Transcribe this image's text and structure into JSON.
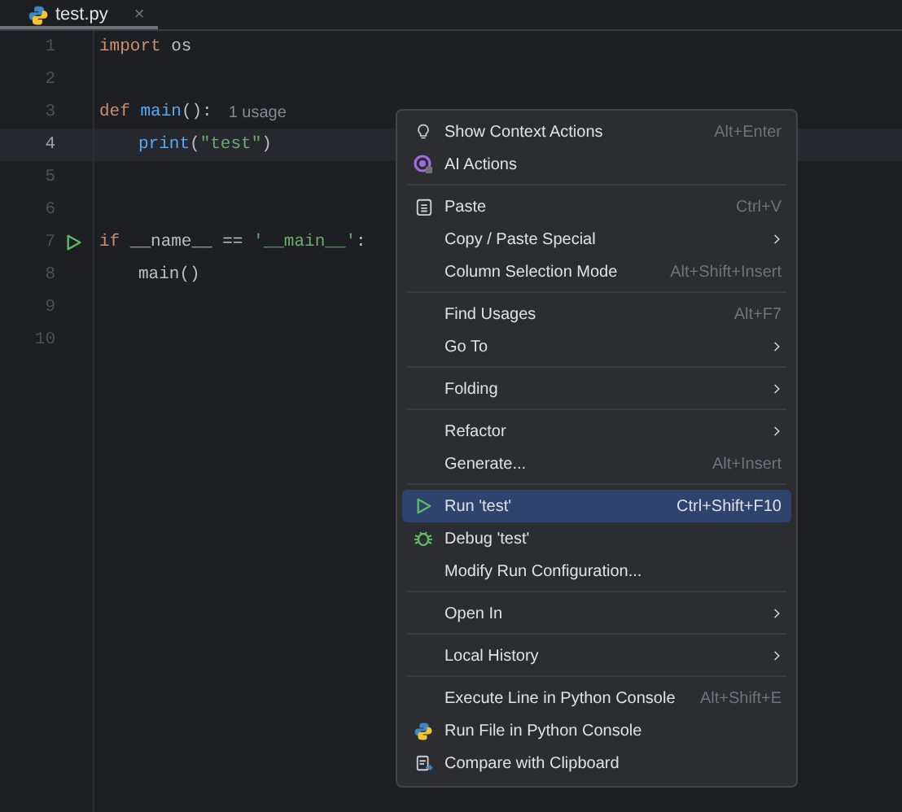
{
  "tab": {
    "title": "test.py",
    "close": "×",
    "selected": true
  },
  "editor": {
    "lines": [
      {
        "number": "1",
        "current": false,
        "run_marker": false,
        "indented": false,
        "tokens": [
          {
            "kind": "keyword",
            "text": "import"
          },
          {
            "kind": "plain",
            "text": " os"
          }
        ]
      },
      {
        "number": "2",
        "current": false,
        "run_marker": false,
        "indented": false
      },
      {
        "number": "3",
        "current": false,
        "run_marker": false,
        "indented": false,
        "tokens": [
          {
            "kind": "keyword",
            "text": "def "
          },
          {
            "kind": "func",
            "text": "main"
          },
          {
            "kind": "plain",
            "text": "():"
          },
          {
            "kind": "hint",
            "text": "1 usage"
          }
        ]
      },
      {
        "number": "4",
        "current": true,
        "run_marker": false,
        "indented": true,
        "tokens": [
          {
            "kind": "func",
            "text": "print"
          },
          {
            "kind": "plain",
            "text": "("
          },
          {
            "kind": "string",
            "text": "\"test\""
          },
          {
            "kind": "plain",
            "text": ")"
          }
        ]
      },
      {
        "number": "5",
        "current": false,
        "run_marker": false,
        "indented": false
      },
      {
        "number": "6",
        "current": false,
        "run_marker": false,
        "indented": false
      },
      {
        "number": "7",
        "current": false,
        "run_marker": true,
        "indented": false,
        "tokens": [
          {
            "kind": "keyword",
            "text": "if"
          },
          {
            "kind": "plain",
            "text": " __name__ == "
          },
          {
            "kind": "string",
            "text": "'__main__'"
          },
          {
            "kind": "plain",
            "text": ":"
          }
        ]
      },
      {
        "number": "8",
        "current": false,
        "run_marker": false,
        "indented": true,
        "tokens": [
          {
            "kind": "plain",
            "text": "main()"
          }
        ]
      },
      {
        "number": "9",
        "current": false,
        "run_marker": false,
        "indented": false
      },
      {
        "number": "10",
        "current": false,
        "run_marker": false,
        "indented": false
      }
    ]
  },
  "context_menu": {
    "groups": [
      [
        {
          "kind": "bulb",
          "label": "Show Context Actions",
          "shortcut": "Alt+Enter",
          "submenu": false,
          "selected": false
        },
        {
          "kind": "ai",
          "label": "AI Actions",
          "submenu": false,
          "selected": false
        }
      ],
      [
        {
          "kind": "clipboard",
          "label": "Paste",
          "shortcut": "Ctrl+V",
          "submenu": false,
          "selected": false
        },
        {
          "kind": "plain",
          "label": "Copy / Paste Special",
          "submenu": true,
          "selected": false
        },
        {
          "kind": "plain",
          "label": "Column Selection Mode",
          "shortcut": "Alt+Shift+Insert",
          "submenu": false,
          "selected": false
        }
      ],
      [
        {
          "kind": "plain",
          "label": "Find Usages",
          "shortcut": "Alt+F7",
          "submenu": false,
          "selected": false
        },
        {
          "kind": "plain",
          "label": "Go To",
          "submenu": true,
          "selected": false
        }
      ],
      [
        {
          "kind": "plain",
          "label": "Folding",
          "submenu": true,
          "selected": false
        }
      ],
      [
        {
          "kind": "plain",
          "label": "Refactor",
          "submenu": true,
          "selected": false
        },
        {
          "kind": "plain",
          "label": "Generate...",
          "shortcut": "Alt+Insert",
          "submenu": false,
          "selected": false
        }
      ],
      [
        {
          "kind": "run",
          "label": "Run 'test'",
          "shortcut": "Ctrl+Shift+F10",
          "submenu": false,
          "selected": true
        },
        {
          "kind": "debug",
          "label": "Debug 'test'",
          "submenu": false,
          "selected": false
        },
        {
          "kind": "plain",
          "label": "Modify Run Configuration...",
          "submenu": false,
          "selected": false
        }
      ],
      [
        {
          "kind": "plain",
          "label": "Open In",
          "submenu": true,
          "selected": false
        }
      ],
      [
        {
          "kind": "plain",
          "label": "Local History",
          "submenu": true,
          "selected": false
        }
      ],
      [
        {
          "kind": "plain",
          "label": "Execute Line in Python Console",
          "shortcut": "Alt+Shift+E",
          "submenu": false,
          "selected": false
        },
        {
          "kind": "python",
          "label": "Run File in Python Console",
          "submenu": false,
          "selected": false
        },
        {
          "kind": "compare",
          "label": "Compare with Clipboard",
          "submenu": false,
          "selected": false
        }
      ]
    ]
  }
}
